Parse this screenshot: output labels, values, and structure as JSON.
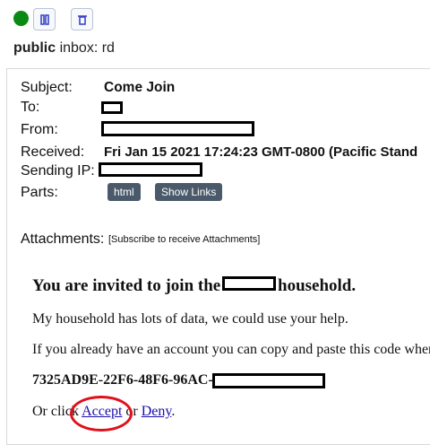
{
  "toolbar": {
    "status_icon": "status-online-icon",
    "pause_icon": "pause-icon",
    "delete_icon": "trash-icon",
    "accent": "#3b45c7",
    "status_color": "#0a8a12"
  },
  "inbox": {
    "visibility": "public",
    "label": "inbox:",
    "name": "rd"
  },
  "message": {
    "subject_label": "Subject:",
    "subject": "Come Join",
    "to_label": "To:",
    "from_label": "From:",
    "received_label": "Received:",
    "received": "Fri Jan 15 2021 17:24:23 GMT-0800 (Pacific Stand",
    "sending_ip_label": "Sending IP:",
    "parts_label": "Parts:",
    "parts": [
      "html",
      "Show Links"
    ],
    "attachments_label": "Attachments:",
    "attachments_link": "[Subscribe to receive Attachments]"
  },
  "body": {
    "heading_start": "You are invited to join the",
    "heading_end": "household.",
    "p1": "My household has lots of data, we could use your help.",
    "p2": "If you already have an account you can copy and paste this code wher",
    "code_prefix": "7325AD9E-22F6-48F6-96AC-",
    "or_click": "Or click",
    "accept": "Accept",
    "or": "or",
    "deny": "Deny",
    "period": "."
  }
}
